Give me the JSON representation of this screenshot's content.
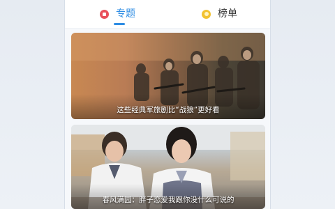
{
  "tabs": [
    {
      "label": "专题",
      "icon": "topic-icon",
      "color": "#e8505b",
      "active": true
    },
    {
      "label": "榜单",
      "icon": "ranking-icon",
      "color": "#f2c230",
      "active": false
    }
  ],
  "accent_color": "#2f8de4",
  "cards": [
    {
      "caption": "这些经典军旅剧比“战狼”更好看",
      "image": "military-soldiers-photo"
    },
    {
      "caption": "春风满园：胖子恋爱我跟你没什么可说的",
      "image": "school-students-photo"
    }
  ]
}
